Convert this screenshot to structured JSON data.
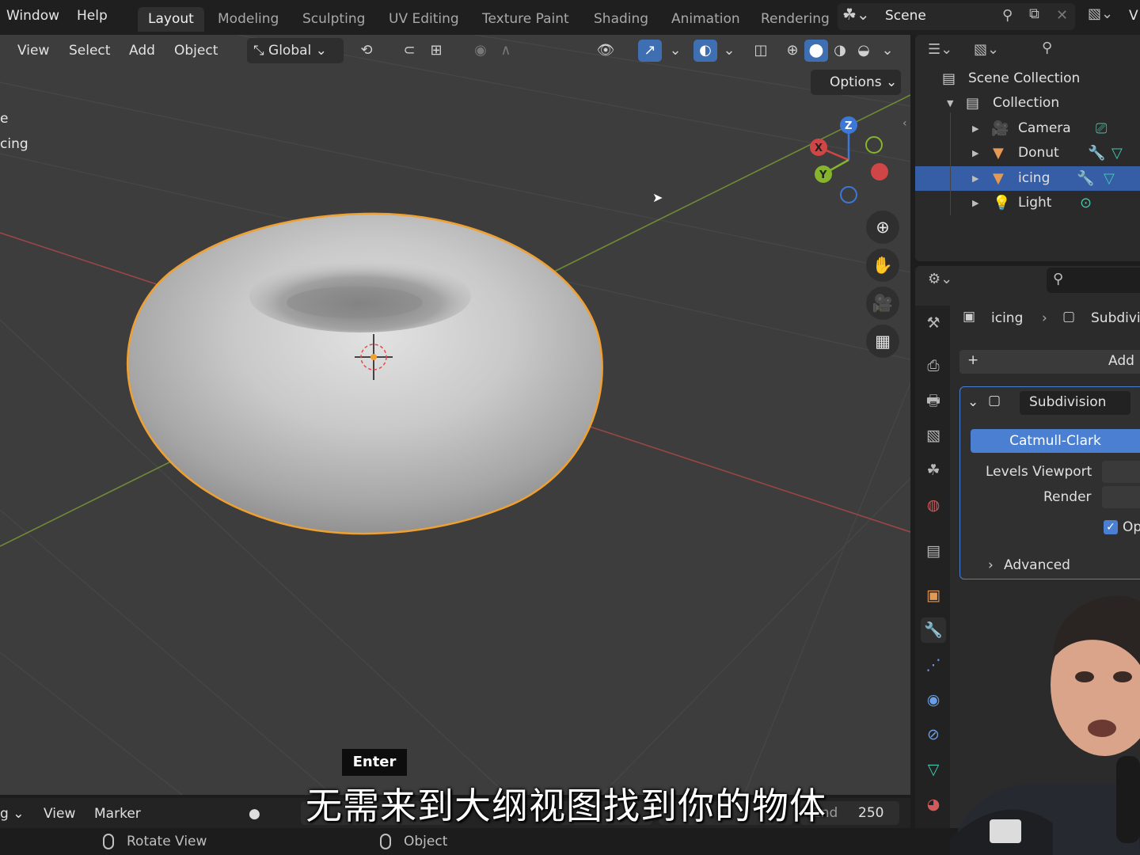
{
  "topbar": {
    "menus": [
      "Window",
      "Help"
    ],
    "workspaces": [
      "Layout",
      "Modeling",
      "Sculpting",
      "UV Editing",
      "Texture Paint",
      "Shading",
      "Animation",
      "Rendering"
    ],
    "active_workspace": "Layout",
    "scene": "Scene",
    "view_layer_partial": "V"
  },
  "viewport": {
    "menus": [
      "View",
      "Select",
      "Add",
      "Object"
    ],
    "transform_orientation": "Global",
    "options_label": "Options",
    "overlay_text": [
      "e",
      "cing"
    ],
    "gizmo": {
      "x": "X",
      "y": "Y",
      "z": "Z"
    }
  },
  "outliner": {
    "items": [
      {
        "label": "Scene Collection"
      },
      {
        "label": "Collection"
      },
      {
        "label": "Camera"
      },
      {
        "label": "Donut"
      },
      {
        "label": "icing"
      },
      {
        "label": "Light"
      }
    ],
    "selected": "icing"
  },
  "properties": {
    "breadcrumb": {
      "object": "icing",
      "modifier": "Subdivi"
    },
    "add_modifier_label": "Add",
    "modifier_name": "Subdivision",
    "method": "Catmull-Clark",
    "levels_viewport_label": "Levels Viewport",
    "render_label": "Render",
    "optimal_display_partial": "Op",
    "advanced_label": "Advanced"
  },
  "timeline": {
    "playback_partial": "g",
    "view_label": "View",
    "marker_label": "Marker",
    "end_partial": "End",
    "end_value": "250"
  },
  "status": {
    "left_action": "Rotate View",
    "right_action": "Object"
  },
  "key_hint": "Enter",
  "subtitle": "无需来到大纲视图找到你的物体",
  "colors": {
    "selection_blue": "#355ea6",
    "accent_blue": "#4a7fd1",
    "outline_orange": "#f0a030",
    "axis_red": "#b84646",
    "axis_green": "#7a9a3a"
  }
}
